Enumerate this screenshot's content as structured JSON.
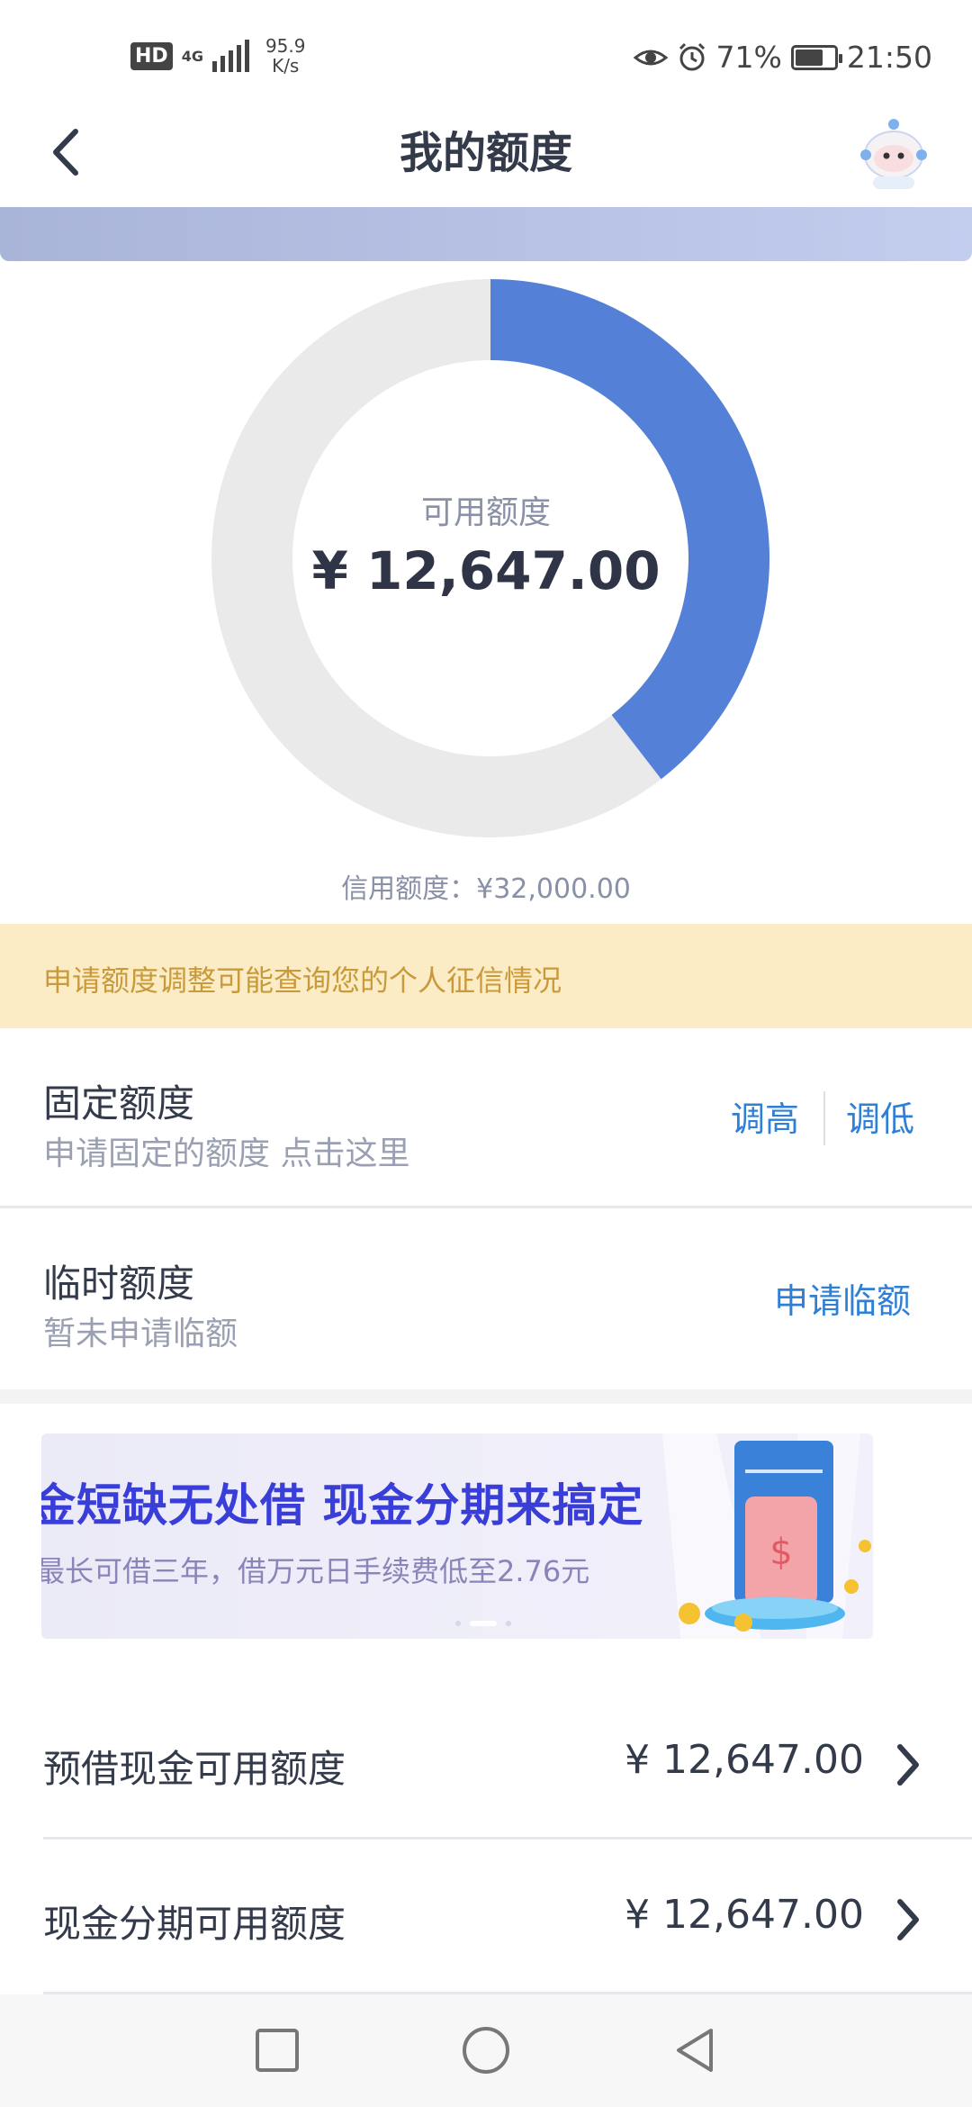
{
  "status_bar": {
    "hd": "HD",
    "network_type": "4G",
    "net_speed_value": "95.9",
    "net_speed_unit": "K/s",
    "battery": "71%",
    "battery_level": 0.71,
    "time": "21:50"
  },
  "header": {
    "title": "我的额度"
  },
  "donut": {
    "available_label": "可用额度",
    "available_amount": "¥ 12,647.00",
    "credit_limit": "信用额度：¥32,000.00",
    "available_value": 12647,
    "total_value": 32000,
    "used_color": "#eaeaea",
    "available_color": "#5580d8"
  },
  "notice": {
    "text": "申请额度调整可能查询您的个人征信情况"
  },
  "fixed_quota": {
    "title": "固定额度",
    "subtitle": "申请固定的额度 点击这里",
    "increase": "调高",
    "decrease": "调低"
  },
  "temp_quota": {
    "title": "临时额度",
    "subtitle": "暂未申请临额",
    "apply": "申请临额"
  },
  "banner": {
    "title": "金短缺无处借 现金分期来搞定",
    "subtitle": "最长可借三年，借万元日手续费低至2.76元"
  },
  "amounts": [
    {
      "label": "预借现金可用额度",
      "value": "¥ 12,647.00"
    },
    {
      "label": "现金分期可用额度",
      "value": "¥ 12,647.00"
    }
  ]
}
